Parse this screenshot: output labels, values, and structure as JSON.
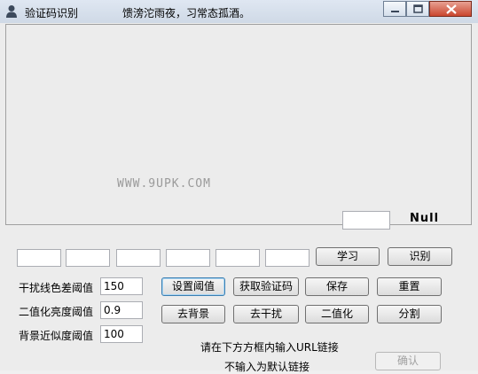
{
  "titlebar": {
    "title": "验证码识别",
    "slogan": "馈滂沱雨夜，习常态孤酒。"
  },
  "watermark": "WWW.9UPK.COM",
  "result": {
    "value": "",
    "label": "Null"
  },
  "char_boxes": [
    "",
    "",
    "",
    "",
    "",
    ""
  ],
  "buttons": {
    "learn": "学习",
    "recognize": "识别",
    "set_threshold": "设置阈值",
    "get_captcha": "获取验证码",
    "save": "保存",
    "reset": "重置",
    "remove_background": "去背景",
    "remove_noise": "去干扰",
    "binarize": "二值化",
    "split": "分割",
    "confirm": "确认"
  },
  "params": {
    "noise_line_label": "干扰线色差阈值",
    "noise_line_value": "150",
    "binarize_label": "二值化亮度阈值",
    "binarize_value": "0.9",
    "bg_label": "背景近似度阈值",
    "bg_value": "100"
  },
  "url_hint": "请在下方方框内输入URL链接",
  "url_default_hint": "不输入为默认链接"
}
